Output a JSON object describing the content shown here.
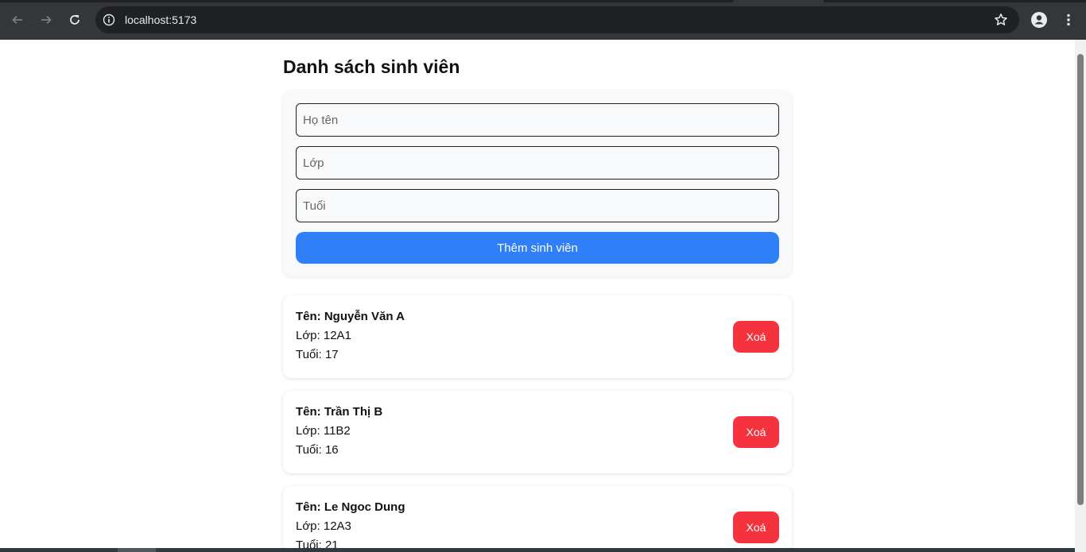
{
  "browser": {
    "url": "localhost:5173",
    "icons": {
      "back": "arrow-left-icon",
      "forward": "arrow-right-icon",
      "reload": "reload-icon",
      "site_info": "info-icon",
      "bookmark": "star-icon",
      "profile": "person-icon",
      "menu": "kebab-menu-icon"
    }
  },
  "page": {
    "title": "Danh sách sinh viên",
    "form": {
      "name_placeholder": "Họ tên",
      "name_value": "",
      "class_placeholder": "Lớp",
      "class_value": "",
      "age_placeholder": "Tuổi",
      "age_value": "",
      "submit_label": "Thêm sinh viên"
    },
    "students": [
      {
        "name": "Tên: Nguyễn Văn A",
        "class": "Lớp: 12A1",
        "age": "Tuổi: 17",
        "delete_label": "Xoá"
      },
      {
        "name": "Tên: Trần Thị B",
        "class": "Lớp: 11B2",
        "age": "Tuổi: 16",
        "delete_label": "Xoá"
      },
      {
        "name": "Tên: Le Ngoc Dung",
        "class": "Lớp: 12A3",
        "age": "Tuổi: 21",
        "delete_label": "Xoá"
      }
    ]
  },
  "colors": {
    "primary_button": "#2f80f7",
    "danger_button": "#f5333f",
    "browser_chrome": "#35363a"
  }
}
